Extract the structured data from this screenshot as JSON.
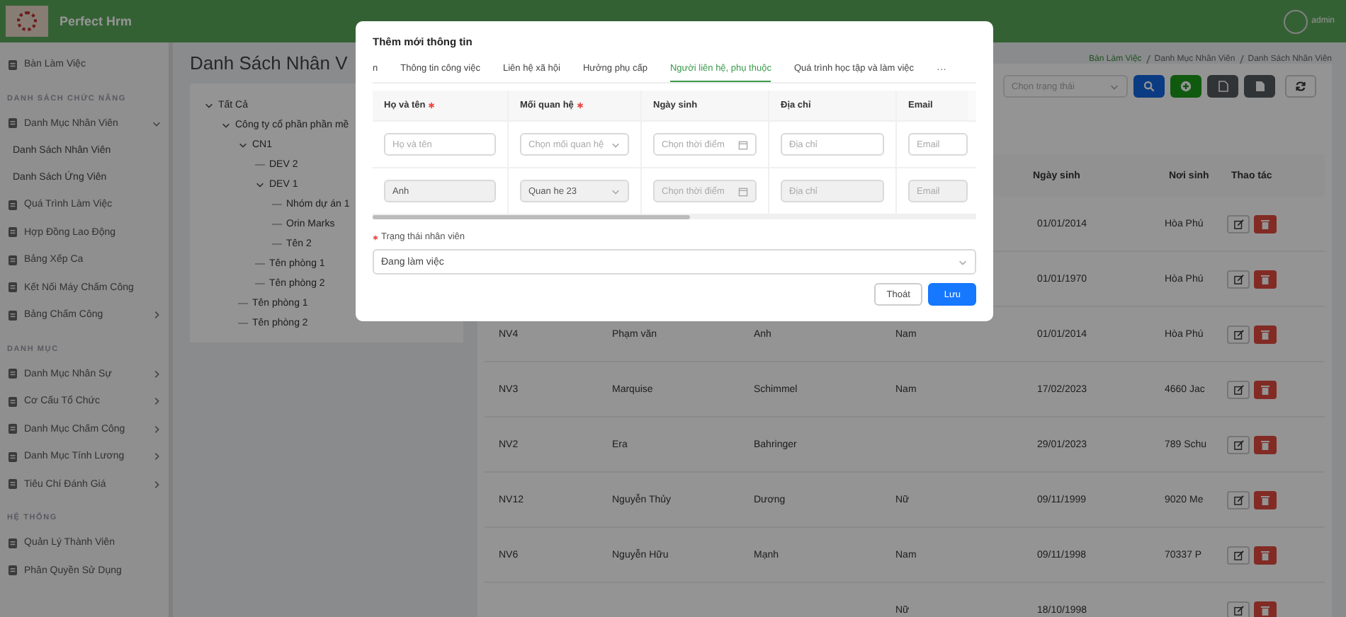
{
  "header": {
    "app_name": "Perfect Hrm",
    "user": "admin"
  },
  "sidebar": {
    "sections": [
      {
        "items": [
          {
            "label": "Bàn Làm Việc"
          }
        ]
      },
      {
        "title": "DANH SÁCH CHỨC NĂNG",
        "items": [
          {
            "label": "Danh Mục Nhân Viên",
            "expanded": true,
            "children": [
              {
                "label": "Danh Sách Nhân Viên"
              },
              {
                "label": "Danh Sách Ứng Viên"
              }
            ]
          },
          {
            "label": "Quá Trình Làm Việc"
          },
          {
            "label": "Hợp Đồng Lao Động"
          },
          {
            "label": "Bảng Xếp Ca"
          },
          {
            "label": "Kết Nối Máy Chấm Công"
          },
          {
            "label": "Bảng Chấm Công",
            "expanded": false
          }
        ]
      },
      {
        "title": "DANH MỤC",
        "items": [
          {
            "label": "Danh Mục Nhân Sự",
            "expanded": false
          },
          {
            "label": "Cơ Cấu Tổ Chức",
            "expanded": false
          },
          {
            "label": "Danh Mục Chấm Công",
            "expanded": false
          },
          {
            "label": "Danh Mục Tính Lương",
            "expanded": false
          },
          {
            "label": "Tiêu Chí Đánh Giá",
            "expanded": false
          }
        ]
      },
      {
        "title": "HỆ THỐNG",
        "items": [
          {
            "label": "Quản Lý Thành Viên"
          },
          {
            "label": "Phân Quyền Sử Dụng"
          }
        ]
      }
    ]
  },
  "page_title": "Danh Sách Nhân V",
  "breadcrumb": [
    "Bàn Làm Việc",
    "Danh Mục Nhân Viên",
    "Danh Sách Nhân Viên"
  ],
  "tree": [
    {
      "label": "Tất Cả",
      "expanded": true,
      "children": [
        {
          "label": "Công ty cổ phần phần mề",
          "expanded": true,
          "children": [
            {
              "label": "CN1",
              "expanded": true,
              "children": [
                {
                  "label": "DEV 2"
                },
                {
                  "label": "DEV 1",
                  "expanded": true,
                  "children": [
                    {
                      "label": "Nhóm dự án 1"
                    },
                    {
                      "label": "Orin Marks"
                    },
                    {
                      "label": "Tên 2"
                    }
                  ]
                },
                {
                  "label": "Tên phòng 1"
                },
                {
                  "label": "Tên phòng 2"
                }
              ]
            },
            {
              "label": "Tên phòng 1"
            },
            {
              "label": "Tên phòng 2"
            }
          ]
        }
      ]
    }
  ],
  "filter": {
    "status_placeholder": "Chọn trạng thái"
  },
  "table": {
    "headers": [
      "Ngày sinh",
      "Nơi sinh",
      "Thao tác"
    ],
    "rows": [
      {
        "birth_date": "01/01/2014",
        "birth_place": "Hòa Phú"
      },
      {
        "birth_date": "01/01/1970",
        "birth_place": "Hòa Phú"
      },
      {
        "code": "NV4",
        "last_name": "Phạm văn",
        "first_name": "Anh",
        "gender": "Nam",
        "birth_date": "01/01/2014",
        "birth_place": "Hòa Phú"
      },
      {
        "code": "NV3",
        "last_name": "Marquise",
        "first_name": "Schimmel",
        "gender": "Nam",
        "birth_date": "17/02/2023",
        "birth_place": "4660 Jac"
      },
      {
        "code": "NV2",
        "last_name": "Era",
        "first_name": "Bahringer",
        "birth_date": "29/01/2023",
        "birth_place": "789 Schu"
      },
      {
        "code": "NV12",
        "last_name": "Nguyễn Thủy",
        "first_name": "Dương",
        "gender": "Nữ",
        "birth_date": "09/11/1999",
        "birth_place": "9020 Me"
      },
      {
        "code": "NV6",
        "last_name": "Nguyễn Hữu",
        "first_name": "Mạnh",
        "gender": "Nam",
        "birth_date": "09/11/1998",
        "birth_place": "70337 P"
      },
      {
        "gender": "Nữ",
        "birth_date": "18/10/1998"
      }
    ]
  },
  "modal": {
    "title": "Thêm mới thông tin",
    "tabs": [
      {
        "label": "n",
        "selected": false
      },
      {
        "label": "Thông tin công việc",
        "selected": false
      },
      {
        "label": "Liên hệ xã hội",
        "selected": false
      },
      {
        "label": "Hưởng phụ cấp",
        "selected": false
      },
      {
        "label": "Người liên hệ, phụ thuộc",
        "selected": true
      },
      {
        "label": "Quá trình học tập và làm việc",
        "selected": false
      }
    ],
    "more_tabs": "···",
    "columns": [
      {
        "label": "Họ và tên",
        "required": true
      },
      {
        "label": "Mối quan hệ",
        "required": true
      },
      {
        "label": "Ngày sinh",
        "required": false
      },
      {
        "label": "Địa chỉ",
        "required": false
      },
      {
        "label": "Email",
        "required": false
      }
    ],
    "rows": [
      {
        "disabled": false,
        "fields": [
          {
            "kind": "text",
            "placeholder": "Họ và tên"
          },
          {
            "kind": "select",
            "placeholder": "Chọn mối quan hệ"
          },
          {
            "kind": "date",
            "placeholder": "Chọn thời điểm"
          },
          {
            "kind": "text",
            "placeholder": "Địa chỉ"
          },
          {
            "kind": "text",
            "placeholder": "Email"
          }
        ]
      },
      {
        "disabled": true,
        "fields": [
          {
            "kind": "text",
            "value": "Anh"
          },
          {
            "kind": "select",
            "value": "Quan he 23"
          },
          {
            "kind": "date",
            "placeholder": "Chọn thời điểm"
          },
          {
            "kind": "text",
            "placeholder": "Địa chỉ"
          },
          {
            "kind": "text",
            "placeholder": "Email"
          }
        ]
      }
    ],
    "status_label": "Trạng thái nhân viên",
    "status_required": true,
    "status_value": "Đang làm việc",
    "buttons": [
      {
        "label": "Thoát",
        "kind": "default"
      },
      {
        "label": "Lưu",
        "kind": "primary"
      }
    ]
  }
}
